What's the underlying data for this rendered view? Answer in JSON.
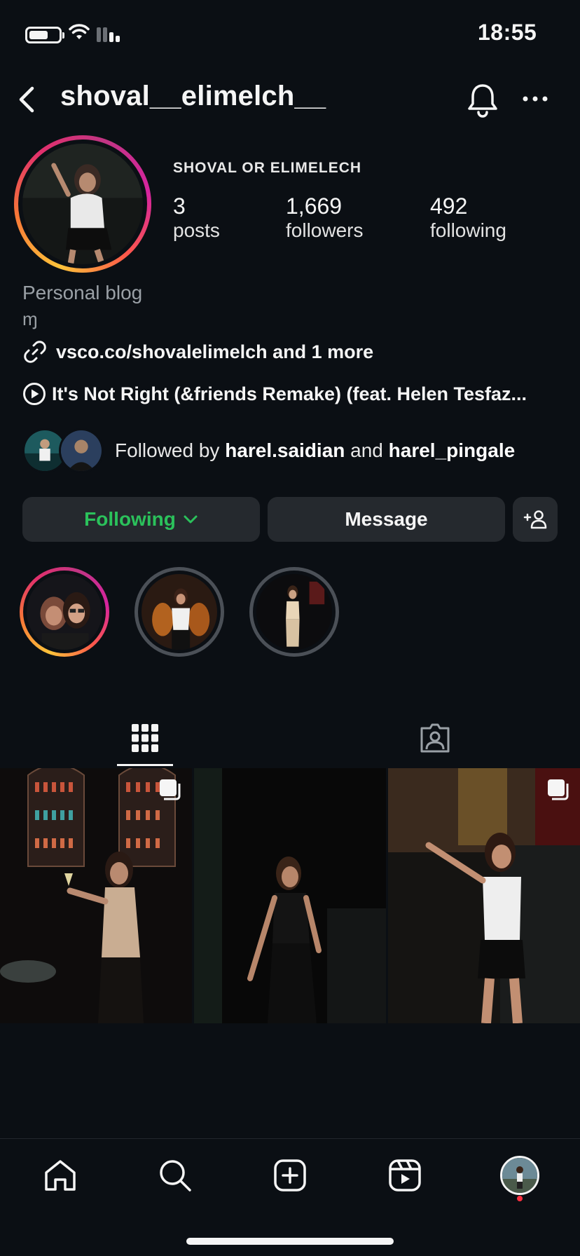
{
  "status_bar": {
    "time": "18:55",
    "battery_icon": "battery-icon",
    "wifi_icon": "wifi-icon",
    "signal_icon": "signal-icon"
  },
  "header": {
    "username": "shoval__elimelch__",
    "back_icon": "chevron-left-icon",
    "bell_icon": "bell-icon",
    "more_icon": "more-horizontal-icon"
  },
  "profile": {
    "display_name": "SHOVAL OR ELIMELECH",
    "stats": [
      {
        "count": "3",
        "label": "posts"
      },
      {
        "count": "1,669",
        "label": "followers"
      },
      {
        "count": "492",
        "label": "following"
      }
    ],
    "category": "Personal blog",
    "bio_glyph": "ɱ",
    "link": {
      "icon": "link-icon",
      "text": "vsco.co/shovalelimelch and 1 more"
    },
    "music": {
      "icon": "play-circle-icon",
      "text": "It's Not Right (&friends Remake) (feat. Helen Tesfaz..."
    },
    "followed_by": {
      "prefix": "Followed by",
      "user1": "harel.saidian",
      "conj": "and",
      "user2": "harel_pingale"
    }
  },
  "actions": {
    "following_label": "Following",
    "message_label": "Message",
    "following_color": "#2bc15b",
    "add_person_icon": "add-person-icon"
  },
  "highlights": [
    {
      "ring": "gradient"
    },
    {
      "ring": "grey"
    },
    {
      "ring": "grey"
    }
  ],
  "tabs": [
    {
      "name": "posts",
      "icon": "grid-icon",
      "active": true
    },
    {
      "name": "tagged",
      "icon": "tagged-person-icon",
      "active": false
    }
  ],
  "posts": [
    {
      "multi": true
    },
    {
      "multi": false
    },
    {
      "multi": true
    }
  ],
  "bottom_nav": [
    {
      "name": "home",
      "icon": "home-icon"
    },
    {
      "name": "search",
      "icon": "search-icon"
    },
    {
      "name": "create",
      "icon": "plus-square-icon"
    },
    {
      "name": "reels",
      "icon": "reels-icon"
    },
    {
      "name": "profile",
      "icon": "avatar"
    }
  ],
  "colors": {
    "background": "#0b0f14",
    "button": "#25292e",
    "story_gradient": [
      "#fdc33a",
      "#e1306c",
      "#c13584"
    ],
    "notification": "#ff3040"
  }
}
